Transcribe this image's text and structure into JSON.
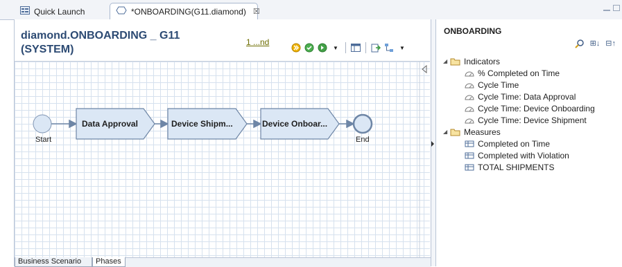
{
  "tabs": {
    "quick_launch": "Quick Launch",
    "editor": "*ONBOARDING(G11.diamond)",
    "close_glyph": "☒"
  },
  "editor": {
    "title_line1": "diamond.ONBOARDING _ G11",
    "title_line2": "(SYSTEM)",
    "phase_link": "1 ...nd"
  },
  "diagram": {
    "start_label": "Start",
    "end_label": "End",
    "steps": [
      "Data Approval",
      "Device Shipm...",
      "Device Onboar..."
    ]
  },
  "bottom_tabs": [
    "Business Scenario",
    "Phases"
  ],
  "panel": {
    "title": "ONBOARDING",
    "groups": [
      {
        "label": "Indicators",
        "items": [
          "% Completed on Time",
          "Cycle Time",
          "Cycle Time: Data Approval",
          "Cycle Time: Device Onboarding",
          "Cycle Time: Device Shipment"
        ]
      },
      {
        "label": "Measures",
        "items": [
          "Completed on Time",
          "Completed with Violation",
          "TOTAL SHIPMENTS"
        ]
      }
    ]
  },
  "colors": {
    "accent": "#2c4a73",
    "shape_fill": "#dbe7f5",
    "shape_stroke": "#6e86a6"
  }
}
